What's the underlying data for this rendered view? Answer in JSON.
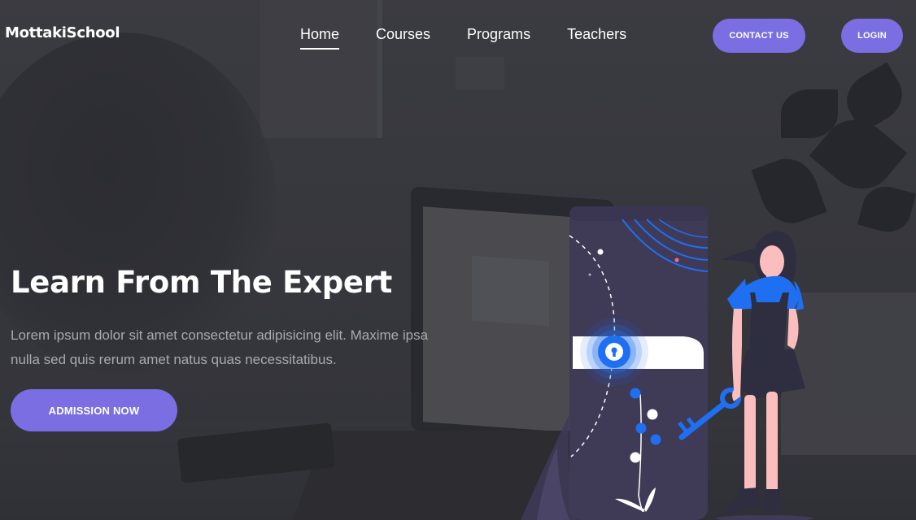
{
  "brand": {
    "name": "MottakiSchool"
  },
  "nav": {
    "items": [
      {
        "label": "Home",
        "active": true
      },
      {
        "label": "Courses",
        "active": false
      },
      {
        "label": "Programs",
        "active": false
      },
      {
        "label": "Teachers",
        "active": false
      }
    ]
  },
  "header": {
    "contact_label": "CONTACT US",
    "login_label": "LOGIN"
  },
  "hero": {
    "title": "Learn From The Expert",
    "text": "Lorem ipsum dolor sit amet consectetur adipisicing elit. Maxime ipsa nulla sed quis rerum amet natus quas necessitatibus.",
    "cta_label": "ADMISSION NOW"
  },
  "colors": {
    "accent": "#7a6ee2",
    "illustration_blue": "#1f6ff2",
    "illustration_phone": "#3f3a56",
    "skin": "#fbbebe"
  },
  "icons": [
    "lock-icon",
    "key-icon"
  ]
}
